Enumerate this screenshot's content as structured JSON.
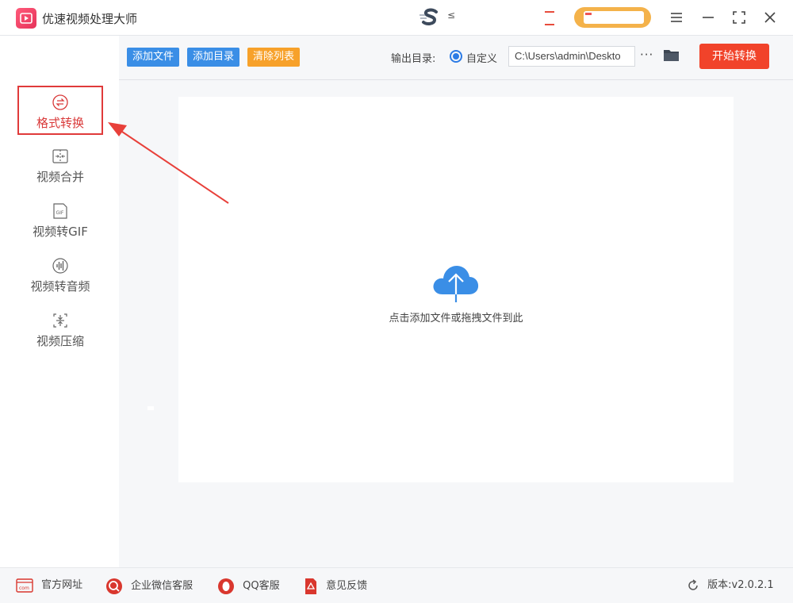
{
  "app": {
    "title": "优速视频处理大师",
    "brand_small": "≤"
  },
  "sidebar": {
    "items": [
      {
        "label": "格式转换",
        "icon": "format-convert-icon",
        "active": true
      },
      {
        "label": "视频合并",
        "icon": "merge-icon",
        "active": false
      },
      {
        "label": "视频转GIF",
        "icon": "gif-icon",
        "active": false
      },
      {
        "label": "视频转音频",
        "icon": "audio-icon",
        "active": false
      },
      {
        "label": "视频压缩",
        "icon": "compress-icon",
        "active": false
      }
    ]
  },
  "toolbar": {
    "add_file": "添加文件",
    "add_dir": "添加目录",
    "clear_list": "清除列表",
    "output_label": "输出目录:",
    "custom_label": "自定义",
    "output_path": "C:\\Users\\admin\\Deskto",
    "more": "···",
    "start": "开始转换"
  },
  "dropzone": {
    "hint": "点击添加文件或拖拽文件到此"
  },
  "statusbar": {
    "website": "官方网址",
    "wechat": "企业微信客服",
    "qq": "QQ客服",
    "feedback": "意见反馈",
    "version": "版本:v2.0.2.1",
    "gif_icon_text": "GIF",
    "com_icon_text": "com"
  },
  "colors": {
    "accent_red": "#f1432a",
    "button_blue": "#3a8ee6",
    "button_orange": "#f7a12a",
    "active_red": "#e03a3a",
    "cloud_blue": "#3a8ee6"
  }
}
